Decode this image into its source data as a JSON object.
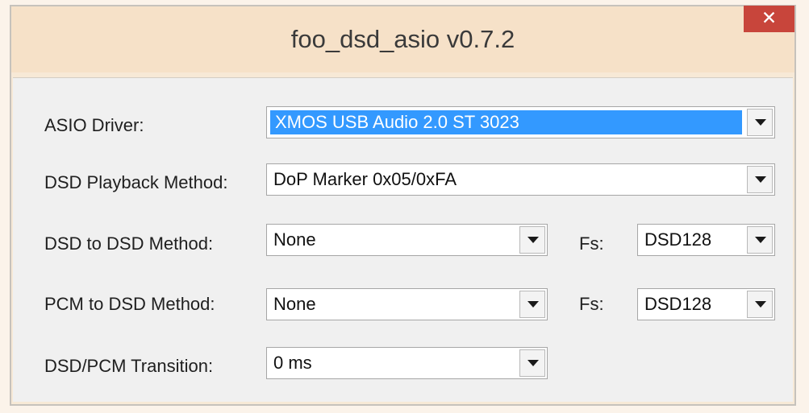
{
  "window": {
    "title": "foo_dsd_asio v0.7.2",
    "close_glyph": "✕"
  },
  "colors": {
    "selection": "#3399ff",
    "close_button": "#c8453b",
    "dialog_background": "#f0f0f0"
  },
  "form": {
    "asio_driver": {
      "label": "ASIO Driver:",
      "value": "XMOS USB Audio 2.0 ST 3023"
    },
    "dsd_playback_method": {
      "label": "DSD Playback Method:",
      "value": "DoP Marker 0x05/0xFA"
    },
    "dsd_to_dsd_method": {
      "label": "DSD to DSD Method:",
      "value": "None",
      "fs_label": "Fs:",
      "fs_value": "DSD128"
    },
    "pcm_to_dsd_method": {
      "label": "PCM to DSD Method:",
      "value": "None",
      "fs_label": "Fs:",
      "fs_value": "DSD128"
    },
    "dsd_pcm_transition": {
      "label": "DSD/PCM Transition:",
      "value": "0 ms"
    }
  },
  "icons": {
    "close": "close-icon",
    "dropdown": "chevron-down-icon"
  }
}
